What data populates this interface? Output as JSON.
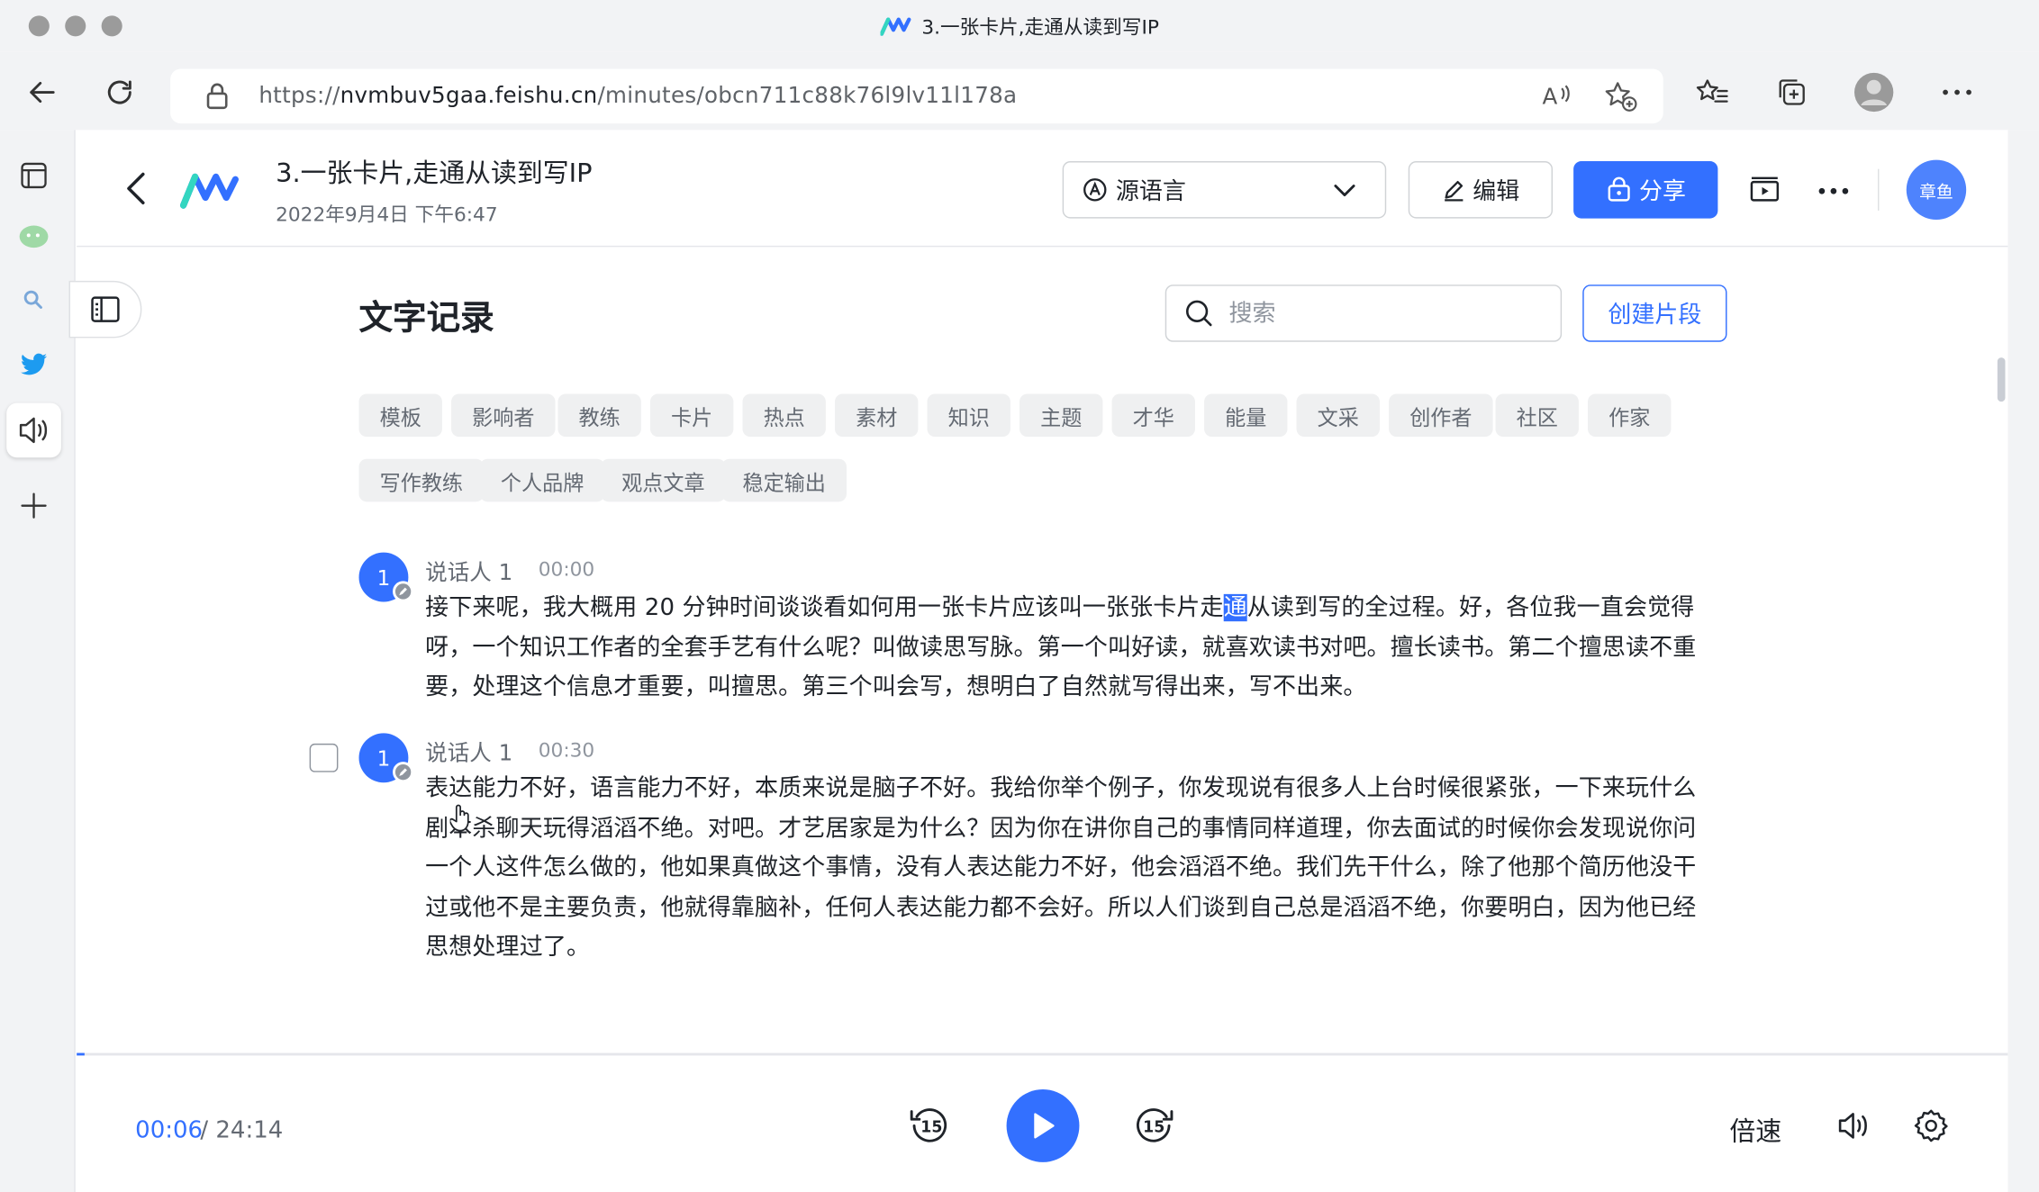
{
  "window": {
    "title": "3.一张卡片,走通从读到写IP"
  },
  "browser": {
    "url_prefix": "https://",
    "url_host": "nvmbuv5gaa.feishu.cn",
    "url_path": "/minutes/obcn711c88k76l9lv11l178a"
  },
  "header": {
    "title": "3.一张卡片,走通从读到写IP",
    "date": "2022年9月4日 下午6:47",
    "language_label": "源语言",
    "edit_label": "编辑",
    "share_label": "分享",
    "avatar_text": "章鱼"
  },
  "transcript": {
    "section_title": "文字记录",
    "search_placeholder": "搜索",
    "create_clip_label": "创建片段",
    "tags": [
      "模板",
      "影响者",
      "教练",
      "卡片",
      "热点",
      "素材",
      "知识",
      "主题",
      "才华",
      "能量",
      "文采",
      "创作者",
      "社区",
      "作家",
      "写作教练",
      "个人品牌",
      "观点文章",
      "稳定输出"
    ],
    "paragraphs": [
      {
        "speaker_num": "1",
        "speaker": "说话人 1",
        "time": "00:00",
        "text_before": "接下来呢，我大概用 20 分钟时间谈谈看如何用一张卡片应该叫一张张卡片走",
        "text_highlight": "通",
        "text_after": "从读到写的全过程。好，各位我一直会觉得呀，一个知识工作者的全套手艺有什么呢？叫做读思写脉。第一个叫好读，就喜欢读书对吧。擅长读书。第二个擅思读不重要，处理这个信息才重要，叫擅思。第三个叫会写，想明白了自然就写得出来，写不出来。"
      },
      {
        "speaker_num": "1",
        "speaker": "说话人 1",
        "time": "00:30",
        "text": "表达能力不好，语言能力不好，本质来说是脑子不好。我给你举个例子，你发现说有很多人上台时候很紧张，一下来玩什么剧本杀聊天玩得滔滔不绝。对吧。才艺居家是为什么？因为你在讲你自己的事情同样道理，你去面试的时候你会发现说你问一个人这件怎么做的，他如果真做这个事情，没有人表达能力不好，他会滔滔不绝。我们先干什么，除了他那个简历他没干过或他不是主要负责，他就得靠脑补，任何人表达能力都不会好。所以人们谈到自己总是滔滔不绝，你要明白，因为他已经思想处理过了。"
      }
    ]
  },
  "player": {
    "current_time": "00:06",
    "total_time": "/ 24:14",
    "progress_fraction": 0.004,
    "speed_label": "倍速",
    "skip_back": "15",
    "skip_forward": "15"
  },
  "colors": {
    "accent": "#3370ff",
    "text": "#1f2329",
    "muted": "#646a73"
  }
}
